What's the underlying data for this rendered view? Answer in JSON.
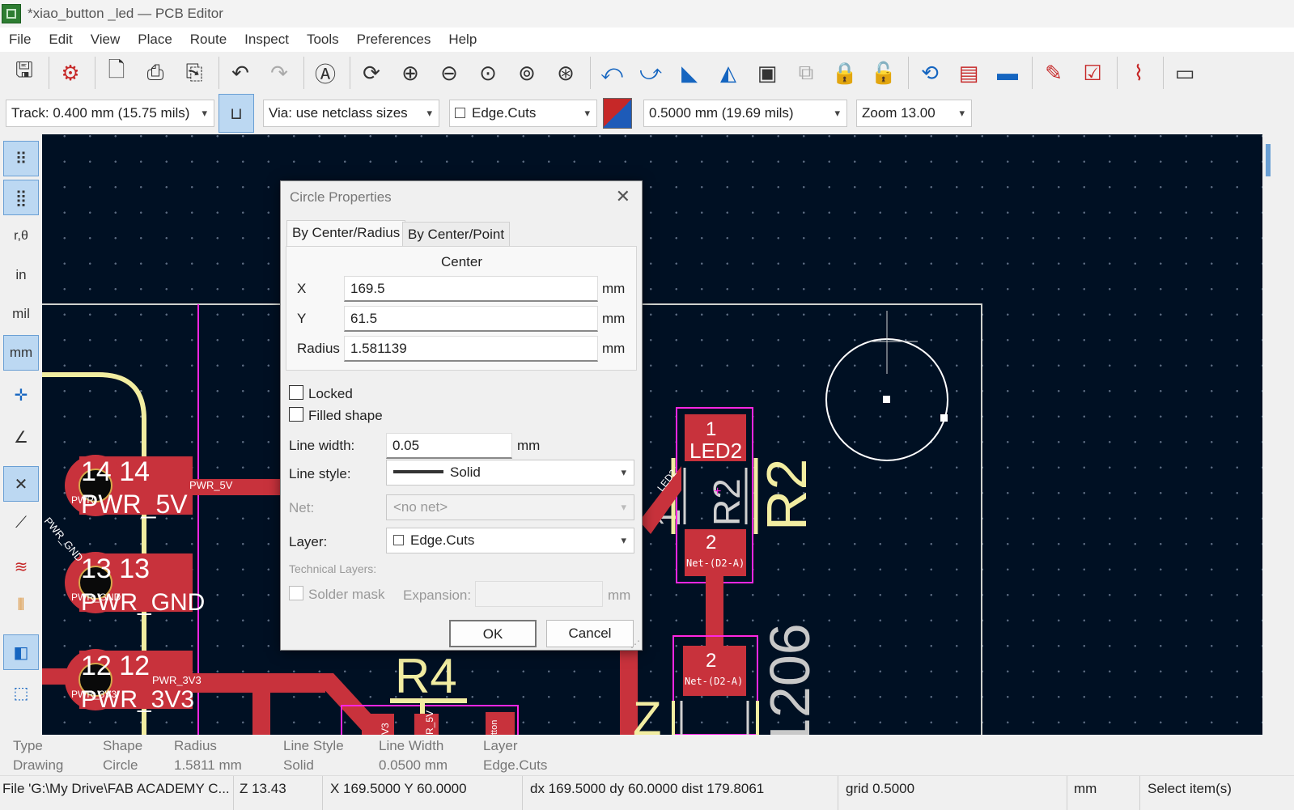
{
  "window": {
    "title": "*xiao_button _led — PCB Editor"
  },
  "menu": [
    "File",
    "Edit",
    "View",
    "Place",
    "Route",
    "Inspect",
    "Tools",
    "Preferences",
    "Help"
  ],
  "toolbar_icons": [
    "save-icon",
    "board-setup-icon",
    "page-settings-icon",
    "print-icon",
    "plot-icon",
    "undo-icon",
    "redo-icon",
    "find-icon",
    "refresh-icon",
    "zoom-in-icon",
    "zoom-out-icon",
    "zoom-fit-icon",
    "zoom-objects-icon",
    "zoom-selection-icon",
    "rotate-ccw-icon",
    "rotate-cw-icon",
    "flip-icon",
    "mirror-icon",
    "group-icon",
    "ungroup-icon",
    "lock-icon",
    "unlock-icon",
    "update-pcb-icon",
    "footprint-library-icon",
    "footprint-editor-icon",
    "netlist-icon",
    "drc-icon",
    "router-icon",
    "scripting-console-icon"
  ],
  "aux": {
    "track": "Track: 0.400 mm (15.75 mils)",
    "via": "Via: use netclass sizes",
    "layer": "Edge.Cuts",
    "grid": "0.5000 mm (19.69 mils)",
    "zoom": "Zoom 13.00"
  },
  "left_tools": [
    {
      "icon": "grid-dots-icon",
      "text": "⠿"
    },
    {
      "icon": "grid-overrides-icon",
      "text": "⣿"
    },
    {
      "icon": "polar-coords-icon",
      "text": "r,θ"
    },
    {
      "icon": "units-inch-icon",
      "text": "in"
    },
    {
      "icon": "units-mil-icon",
      "text": "mil"
    },
    {
      "icon": "units-mm-icon",
      "text": "mm"
    },
    {
      "icon": "cursor-crosshair-icon",
      "text": "✛"
    },
    {
      "icon": "angle-snap-icon",
      "text": "∠"
    },
    {
      "icon": "ratsnest-icon",
      "text": "✕"
    },
    {
      "icon": "curved-ratsnest-icon",
      "text": "⟋"
    },
    {
      "icon": "track-outline-icon",
      "text": "≋"
    },
    {
      "icon": "via-outline-icon",
      "text": "⫴"
    },
    {
      "icon": "high-contrast-icon",
      "text": "◧"
    },
    {
      "icon": "board-bounds-icon",
      "text": "⬚"
    }
  ],
  "dialog": {
    "title": "Circle Properties",
    "tabs": [
      "By Center/Radius",
      "By Center/Point"
    ],
    "center_label": "Center",
    "x_label": "X",
    "x_value": "169.5",
    "y_label": "Y",
    "y_value": "61.5",
    "radius_label": "Radius",
    "radius_value": "1.581139",
    "unit": "mm",
    "locked": "Locked",
    "filled": "Filled shape",
    "line_width_label": "Line width:",
    "line_width_value": "0.05",
    "line_style_label": "Line style:",
    "line_style_value": "Solid",
    "net_label": "Net:",
    "net_value": "<no net>",
    "layer_label": "Layer:",
    "layer_value": "Edge.Cuts",
    "technical_layers": "Technical Layers:",
    "solder_mask": "Solder mask",
    "expansion": "Expansion:",
    "ok": "OK",
    "cancel": "Cancel"
  },
  "pcb": {
    "pads_left": [
      {
        "num": "14 14",
        "net": "PWR_5V",
        "label": "PWR_5V"
      },
      {
        "num": "13 13",
        "net": "PWR_GND",
        "label": "PWR_GND"
      },
      {
        "num": "12 12",
        "net": "PWR_3V3",
        "label": "PWR_3V3"
      }
    ],
    "small_labels": {
      "pwr5v_track": "PWR_5V",
      "pwr3v3_track": "PWR_3V3",
      "pwrgnd_diag": "PWR_GND",
      "pwr_small1": "PWR",
      "pwr_small2": "PWR_GND",
      "pwr_small3": "PWR_3V3",
      "v3": "V3",
      "r5v": "R_5V",
      "tton": "tton"
    },
    "led": {
      "pad1": "1",
      "ref": "LED2",
      "pad2": "2",
      "net": "Net-(D2-A)",
      "diag": "LED2"
    },
    "r2": {
      "ref_fab": "R2",
      "ref_silk": "R2"
    },
    "pad2b": {
      "num": "2",
      "net": "Net-(D2-A)"
    },
    "r4": "R4",
    "pkg": "1206",
    "z": "Z",
    "one": "1",
    "colors": {
      "copper": "#c8323c",
      "silk": "#f2eda1",
      "courtyard": "#ff26e2",
      "edge": "#d0d2cd",
      "background": "#001023"
    }
  },
  "info": [
    {
      "label": "Type",
      "value": "Drawing"
    },
    {
      "label": "Shape",
      "value": "Circle"
    },
    {
      "label": "Radius",
      "value": "1.5811 mm"
    },
    {
      "label": "Line Style",
      "value": "Solid"
    },
    {
      "label": "Line Width",
      "value": "0.0500 mm"
    },
    {
      "label": "Layer",
      "value": "Edge.Cuts"
    }
  ],
  "status": {
    "file": "File 'G:\\My Drive\\FAB ACADEMY C...",
    "z": "Z 13.43",
    "xy": "X 169.5000  Y 60.0000",
    "delta": "dx 169.5000  dy 60.0000  dist 179.8061",
    "grid": "grid 0.5000",
    "units": "mm",
    "mode": "Select item(s)"
  }
}
